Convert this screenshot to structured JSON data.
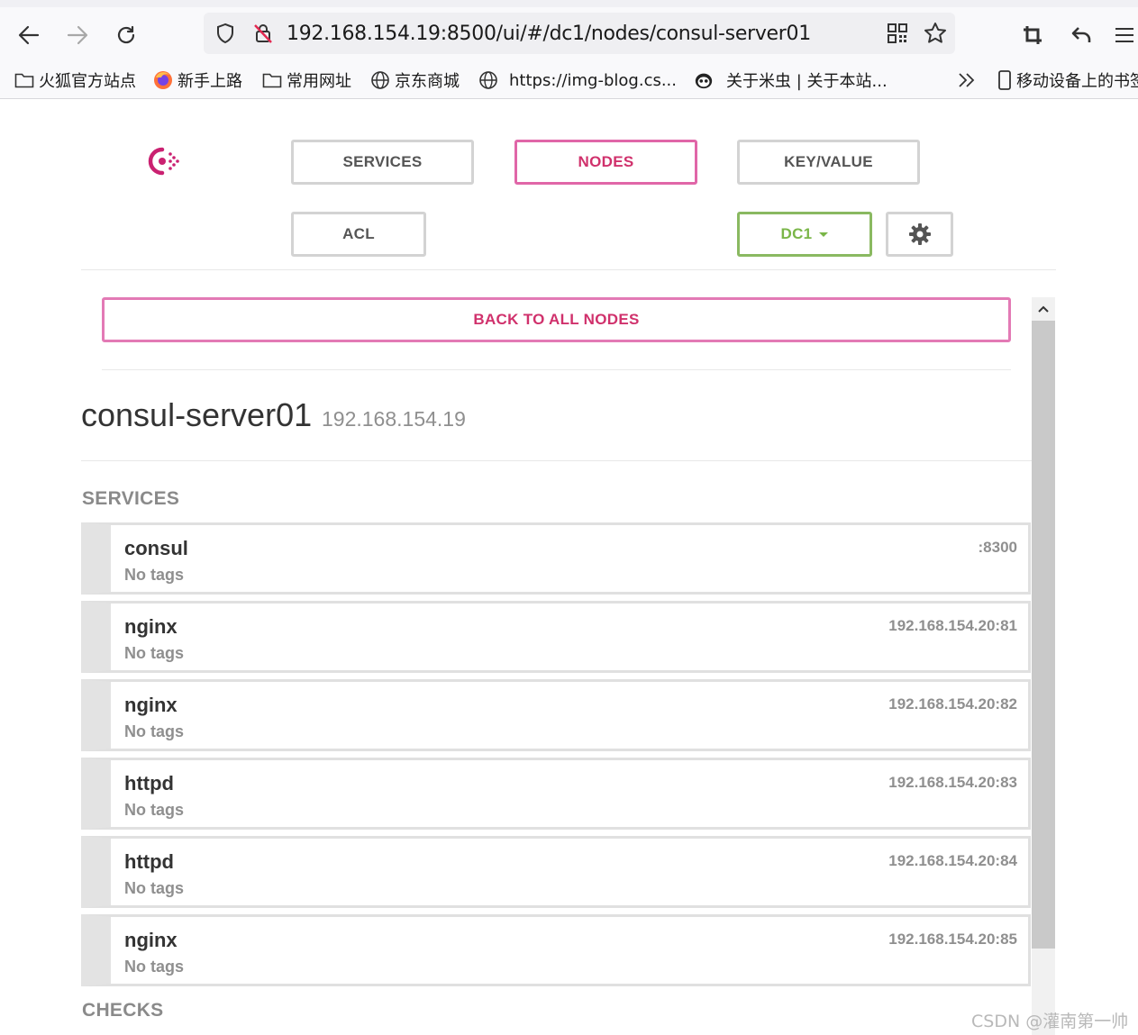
{
  "browser": {
    "url": "192.168.154.19:8500/ui/#/dc1/nodes/consul-server01",
    "bookmarks": [
      {
        "label": "火狐官方站点",
        "icon": "folder-icon"
      },
      {
        "label": "新手上路",
        "icon": "firefox-icon"
      },
      {
        "label": "常用网址",
        "icon": "folder-icon"
      },
      {
        "label": "京东商城",
        "icon": "globe-icon"
      },
      {
        "label": "https://img-blog.cs...",
        "icon": "globe-icon"
      },
      {
        "label": "关于米虫 | 关于本站...",
        "icon": "panda-icon"
      },
      {
        "label": "移动设备上的书签",
        "icon": "mobile-icon"
      }
    ]
  },
  "nav": {
    "services": "SERVICES",
    "nodes": "NODES",
    "keyvalue": "KEY/VALUE",
    "acl": "ACL",
    "datacenter": "DC1"
  },
  "colors": {
    "accent": "#d0316c",
    "accent_border": "#e37ab5",
    "dc_green": "#7ab648"
  },
  "node": {
    "back_label": "BACK TO ALL NODES",
    "name": "consul-server01",
    "ip": "192.168.154.19",
    "services_title": "SERVICES",
    "checks_title": "CHECKS",
    "services": [
      {
        "name": "consul",
        "tags": "No tags",
        "address": ":8300"
      },
      {
        "name": "nginx",
        "tags": "No tags",
        "address": "192.168.154.20:81"
      },
      {
        "name": "nginx",
        "tags": "No tags",
        "address": "192.168.154.20:82"
      },
      {
        "name": "httpd",
        "tags": "No tags",
        "address": "192.168.154.20:83"
      },
      {
        "name": "httpd",
        "tags": "No tags",
        "address": "192.168.154.20:84"
      },
      {
        "name": "nginx",
        "tags": "No tags",
        "address": "192.168.154.20:85"
      }
    ]
  },
  "watermark": "CSDN @灌南第一帅"
}
